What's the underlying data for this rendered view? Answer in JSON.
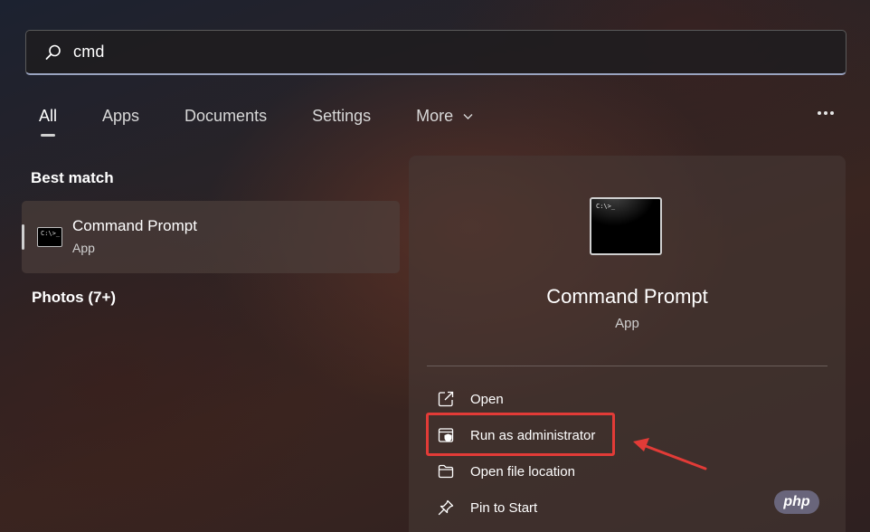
{
  "search": {
    "query": "cmd",
    "icon": "search-icon"
  },
  "tabs": [
    {
      "label": "All",
      "active": true
    },
    {
      "label": "Apps",
      "active": false
    },
    {
      "label": "Documents",
      "active": false
    },
    {
      "label": "Settings",
      "active": false
    },
    {
      "label": "More",
      "active": false,
      "icon": "chevron-down-icon"
    }
  ],
  "overflow_menu_icon": "more-horizontal-icon",
  "results": {
    "best_match_title": "Best match",
    "best_match": {
      "name": "Command Prompt",
      "type": "App",
      "icon": "command-prompt-icon"
    },
    "photos_title": "Photos (7+)"
  },
  "detail": {
    "name": "Command Prompt",
    "type": "App",
    "icon": "command-prompt-icon",
    "actions": [
      {
        "label": "Open",
        "icon": "open-external-icon"
      },
      {
        "label": "Run as administrator",
        "icon": "admin-shield-icon",
        "highlighted": true
      },
      {
        "label": "Open file location",
        "icon": "folder-icon"
      },
      {
        "label": "Pin to Start",
        "icon": "pin-icon"
      }
    ]
  },
  "annotation": {
    "highlight_color": "#e23b37"
  },
  "watermark": {
    "text": "php"
  },
  "colors": {
    "accent_underline": "#9aa4c0",
    "highlight": "#e23b37"
  }
}
